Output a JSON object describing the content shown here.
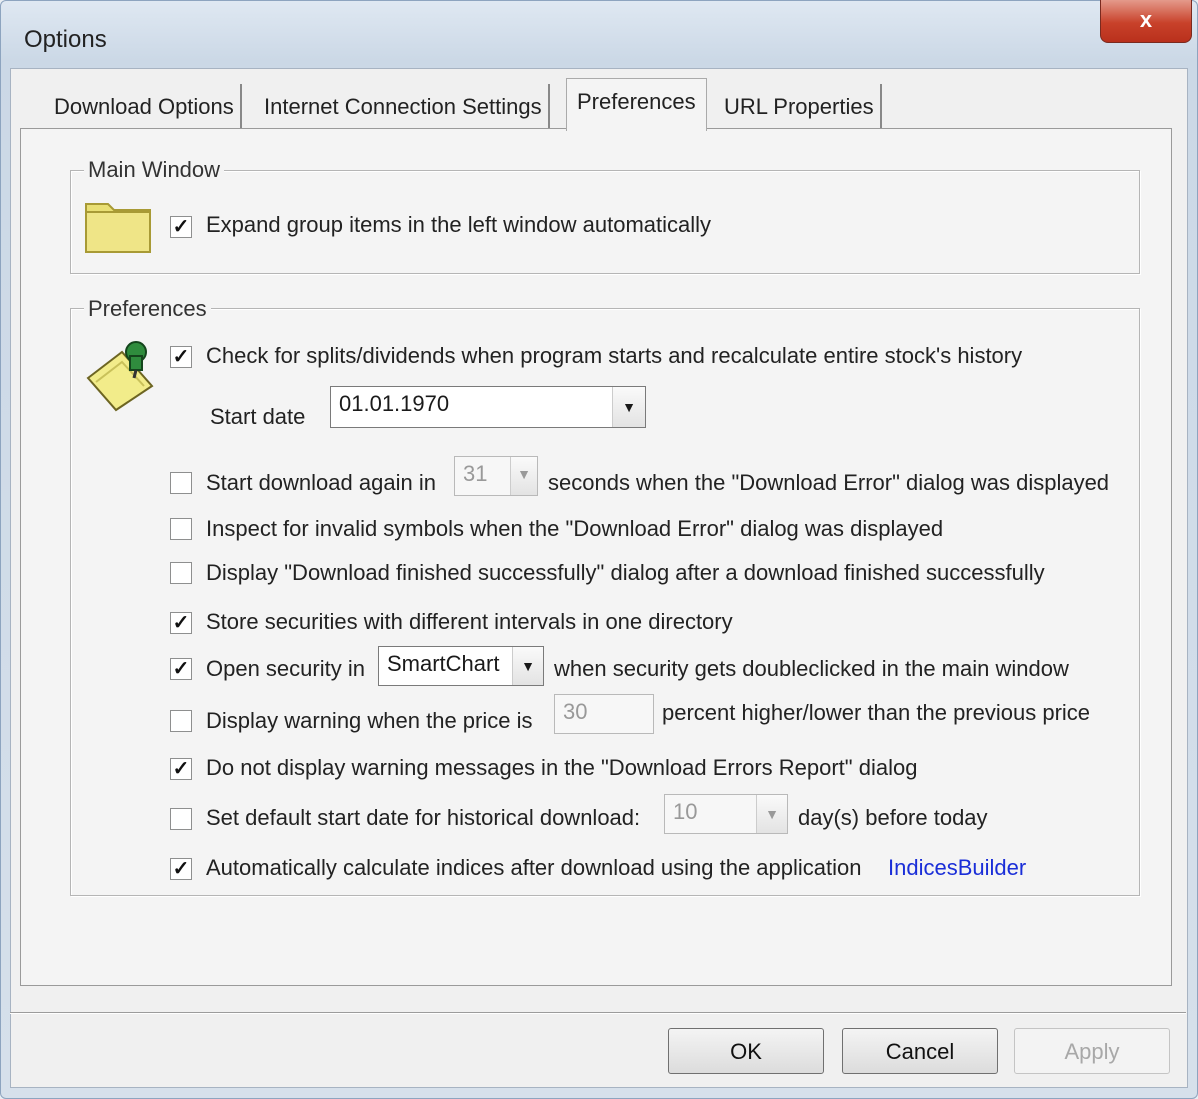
{
  "window": {
    "title": "Options",
    "close_label": "x"
  },
  "tabs": [
    {
      "label": "Download Options"
    },
    {
      "label": "Internet Connection Settings"
    },
    {
      "label": "Preferences"
    },
    {
      "label": "URL Properties"
    }
  ],
  "main_window_group": {
    "title": "Main Window",
    "icon": "folder-icon",
    "expand_checkbox": {
      "checked": true,
      "label": "Expand group items in the left window automatically"
    }
  },
  "preferences_group": {
    "title": "Preferences",
    "icon": "pinned-note-icon",
    "check_splits": {
      "checked": true,
      "label": "Check for splits/dividends when program starts and recalculate entire stock's history"
    },
    "start_date": {
      "label": "Start date",
      "value": "01.01.1970"
    },
    "restart_download": {
      "checked": false,
      "label_before": "Start download again in",
      "value": "31",
      "label_after": "seconds when the \"Download Error\" dialog was displayed"
    },
    "inspect_invalid": {
      "checked": false,
      "label": "Inspect for invalid symbols when the \"Download Error\" dialog was displayed"
    },
    "display_finished": {
      "checked": false,
      "label": "Display \"Download finished successfully\" dialog after a download finished successfully"
    },
    "store_securities": {
      "checked": true,
      "label": "Store securities with different intervals in one directory"
    },
    "open_security": {
      "checked": true,
      "label_before": "Open security in",
      "value": "SmartChart",
      "label_after": "when security gets doubleclicked in the main window"
    },
    "price_warning": {
      "checked": false,
      "label_before": "Display warning when the price is",
      "value": "30",
      "label_after": "percent higher/lower than the previous price"
    },
    "no_warnings": {
      "checked": true,
      "label": "Do not display warning messages in the \"Download Errors Report\" dialog"
    },
    "default_start": {
      "checked": false,
      "label_before": "Set default start date for historical download:",
      "value": "10",
      "label_after": "day(s) before today"
    },
    "auto_indices": {
      "checked": true,
      "label": "Automatically calculate indices after download using the application",
      "link": "IndicesBuilder"
    }
  },
  "buttons": {
    "ok": "OK",
    "cancel": "Cancel",
    "apply": "Apply"
  }
}
